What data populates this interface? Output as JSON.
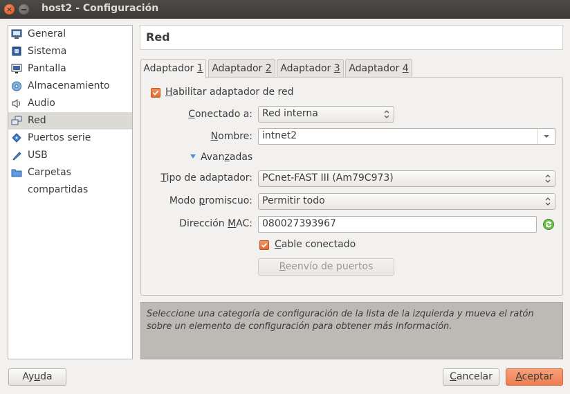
{
  "window": {
    "title": "host2 - Configuración"
  },
  "sidebar": {
    "items": [
      {
        "label": "General",
        "icon": "monitor-info-icon"
      },
      {
        "label": "Sistema",
        "icon": "chip-icon"
      },
      {
        "label": "Pantalla",
        "icon": "display-icon"
      },
      {
        "label": "Almacenamiento",
        "icon": "disk-icon"
      },
      {
        "label": "Audio",
        "icon": "speaker-icon"
      },
      {
        "label": "Red",
        "icon": "network-icon",
        "selected": true
      },
      {
        "label": "Puertos serie",
        "icon": "serial-port-icon"
      },
      {
        "label": "USB",
        "icon": "usb-icon"
      },
      {
        "label": "Carpetas compartidas",
        "icon": "folder-icon"
      }
    ]
  },
  "section": {
    "title": "Red"
  },
  "tabs": [
    {
      "label": "Adaptador ",
      "mnemonic": "1",
      "active": true
    },
    {
      "label": "Adaptador ",
      "mnemonic": "2"
    },
    {
      "label": "Adaptador ",
      "mnemonic": "3"
    },
    {
      "label": "Adaptador ",
      "mnemonic": "4"
    }
  ],
  "adapter": {
    "enable": {
      "pre": "",
      "mnemonic": "H",
      "post": "abilitar adaptador de red",
      "checked": true
    },
    "attached": {
      "label_pre": "",
      "label_mn": "C",
      "label_post": "onectado a:",
      "value": "Red interna"
    },
    "name": {
      "label_pre": "",
      "label_mn": "N",
      "label_post": "ombre:",
      "value": "intnet2"
    },
    "advanced": {
      "pre": "Avan",
      "mnemonic": "z",
      "post": "adas"
    },
    "adapter_type": {
      "label_pre": "",
      "label_mn": "T",
      "label_post": "ipo de adaptador:",
      "value": "PCnet-FAST III (Am79C973)"
    },
    "promisc": {
      "label_pre": "Modo ",
      "label_mn": "p",
      "label_post": "romiscuo:",
      "value": "Permitir todo"
    },
    "mac": {
      "label_pre": "Dirección ",
      "label_mn": "M",
      "label_post": "AC:",
      "value": "080027393967"
    },
    "cable": {
      "pre": "",
      "mnemonic": "C",
      "post": "able conectado",
      "checked": true
    },
    "port_forward": {
      "pre": "",
      "mnemonic": "R",
      "post": "eenvío de puertos"
    }
  },
  "info_text": "Seleccione una categoría de configuración de la lista de la izquierda y mueva el ratón sobre un elemento de configuración para obtener más información.",
  "footer": {
    "help": {
      "pre": "Ay",
      "mnemonic": "u",
      "post": "da"
    },
    "cancel": {
      "pre": "",
      "mnemonic": "C",
      "post": "ancelar"
    },
    "accept": {
      "pre": "",
      "mnemonic": "A",
      "post": "ceptar"
    }
  },
  "colors": {
    "accent": "#ef7e51",
    "titlebar": "#3c3b37",
    "selection": "#dcdad5"
  }
}
